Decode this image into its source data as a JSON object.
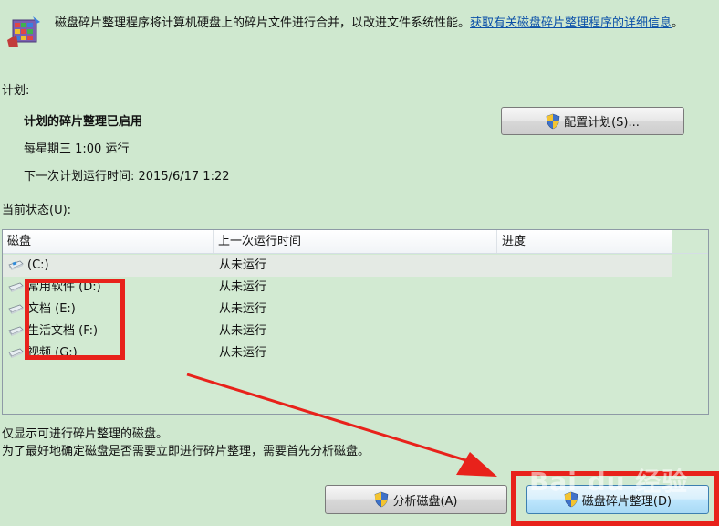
{
  "header": {
    "description": "磁盘碎片整理程序将计算机硬盘上的碎片文件进行合并，以改进文件系统性能。",
    "more_info_link": "获取有关磁盘碎片整理程序的详细信息",
    "trailing_period": "。"
  },
  "schedule": {
    "section_label": "计划:",
    "status": "计划的碎片整理已启用",
    "frequency": "每星期三 1:00 运行",
    "next_run": "下一次计划运行时间: 2015/6/17 1:22",
    "configure_button": "配置计划(S)..."
  },
  "current_status": {
    "section_label": "当前状态(U):",
    "columns": [
      "磁盘",
      "上一次运行时间",
      "进度"
    ],
    "disks": [
      {
        "name": "(C:)",
        "last_run": "从未运行",
        "progress": "",
        "type": "system-drive-icon"
      },
      {
        "name": "常用软件 (D:)",
        "last_run": "从未运行",
        "progress": "",
        "type": "drive-icon"
      },
      {
        "name": "文档 (E:)",
        "last_run": "从未运行",
        "progress": "",
        "type": "drive-icon"
      },
      {
        "name": "生活文档 (F:)",
        "last_run": "从未运行",
        "progress": "",
        "type": "drive-icon"
      },
      {
        "name": "视频 (G:)",
        "last_run": "从未运行",
        "progress": "",
        "type": "drive-icon"
      }
    ]
  },
  "notes": {
    "line1": "仅显示可进行碎片整理的磁盘。",
    "line2": "为了最好地确定磁盘是否需要立即进行碎片整理，需要首先分析磁盘。"
  },
  "actions": {
    "analyze_button": "分析磁盘(A)",
    "defragment_button": "磁盘碎片整理(D)"
  },
  "watermark": "Bai du 经验",
  "colors": {
    "background": "#cfe8cf",
    "link": "#0a4fa8",
    "annotation_red": "#e8221b"
  }
}
